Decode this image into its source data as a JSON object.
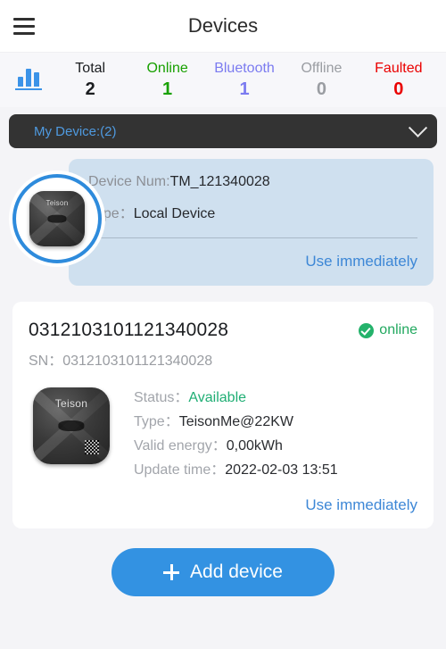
{
  "header": {
    "title": "Devices",
    "menu_icon": "hamburger-menu-icon"
  },
  "stats": {
    "icon": "bar-chart-icon",
    "items": [
      {
        "label": "Total",
        "value": "2",
        "color": "#1b1d20"
      },
      {
        "label": "Online",
        "value": "1",
        "color": "#18a000"
      },
      {
        "label": "Bluetooth",
        "value": "1",
        "color": "#7b7bf0"
      },
      {
        "label": "Offline",
        "value": "0",
        "color": "#9a9da2"
      },
      {
        "label": "Faulted",
        "value": "0",
        "color": "#ea0000"
      }
    ]
  },
  "group_selector": {
    "label": "My Device:(2)",
    "chevron_icon": "chevron-down-icon"
  },
  "local_device": {
    "avatar_icon": "ev-charger-icon",
    "device_num_label": "Device Num:",
    "device_num_value": "TM_121340028",
    "type_label": "Type：",
    "type_value": "Local Device",
    "action": "Use immediately"
  },
  "online_device": {
    "id": "0312103101121340028",
    "status_badge": {
      "icon": "check-circle-icon",
      "text": "online"
    },
    "sn_label": "SN：",
    "sn_value": "0312103101121340028",
    "thumb_icon": "ev-charger-icon",
    "brand": "Teison",
    "details": [
      {
        "label": "Status：",
        "value": "Available",
        "value_color": "#1fae74"
      },
      {
        "label": "Type：",
        "value": "TeisonMe@22KW",
        "value_color": "#2a2c30"
      },
      {
        "label": "Valid energy：",
        "value": "0,00kWh",
        "value_color": "#2a2c30"
      },
      {
        "label": "Update time：",
        "value": "2022-02-03 13:51",
        "value_color": "#2a2c30"
      }
    ],
    "action": "Use immediately"
  },
  "add_button": {
    "label": "Add device",
    "icon": "plus-icon"
  },
  "colors": {
    "accent": "#3392e2",
    "card_blue": "#cfe0ef",
    "dropdown_bg": "#333333",
    "page_bg": "#f4f4f7"
  }
}
